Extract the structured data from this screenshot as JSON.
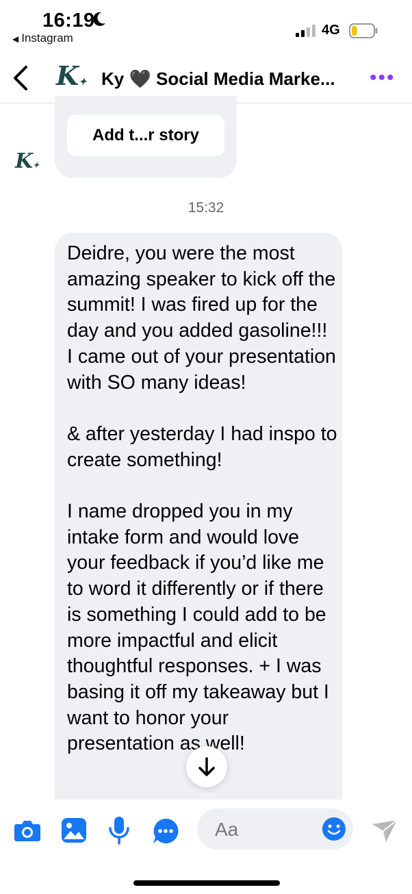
{
  "status_bar": {
    "time": "16:19",
    "back_app": "Instagram",
    "network": "4G",
    "battery_level": 0.25,
    "battery_color": "#f2c200"
  },
  "header": {
    "back_icon": "chevron-left-icon",
    "logo_letter": "K",
    "title": "Ky 🖤 Social Media Marke...",
    "more_icon": "more-horizontal-icon",
    "accent_color": "#8a3ffc"
  },
  "chat": {
    "story_button_label": "Add t...r story",
    "avatar_letter": "K",
    "timestamp": "15:32",
    "message": "Deidre, you were the most amazing speaker to kick off the summit! I was fired up for the day and you added gasoline!!! I came out of your presentation with SO many ideas!\n\n& after yesterday I had inspo to create something!\n\nI name dropped you in my intake form and would love your feedback if you’d like me to word it differently or if there is something I could add to be more impactful and elicit thoughtful responses. + I was basing it off my takeaway but I want to honor your presentation as well!"
  },
  "composer": {
    "placeholder": "Aa",
    "icons": [
      "camera-icon",
      "gallery-icon",
      "microphone-icon",
      "more-options-icon",
      "emoji-icon",
      "send-icon"
    ],
    "icon_color": "#1877f2"
  }
}
